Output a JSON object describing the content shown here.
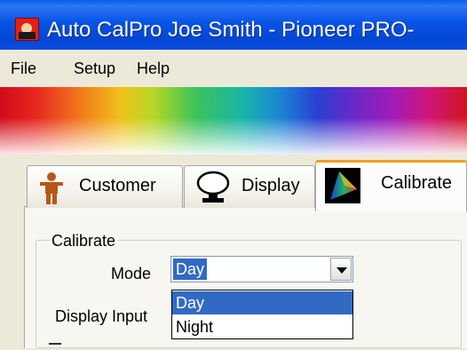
{
  "window": {
    "title": "Auto CalPro  Joe Smith - Pioneer PRO-"
  },
  "menu": {
    "items": [
      "File",
      "Setup",
      "Help"
    ]
  },
  "tabs": [
    {
      "label": "Customer",
      "icon": "person-icon"
    },
    {
      "label": "Display",
      "icon": "display-icon"
    },
    {
      "label": "Calibrate",
      "icon": "color-gamut-icon",
      "active": true
    }
  ],
  "calibrate_group": {
    "title": "Calibrate",
    "mode_label": "Mode",
    "mode_value": "Day",
    "mode_options": [
      "Day",
      "Night"
    ],
    "display_input_label": "Display Input"
  },
  "colors": {
    "selection": "#316ac5",
    "titlebar": "#0653e6",
    "panel": "#ece9d8"
  }
}
